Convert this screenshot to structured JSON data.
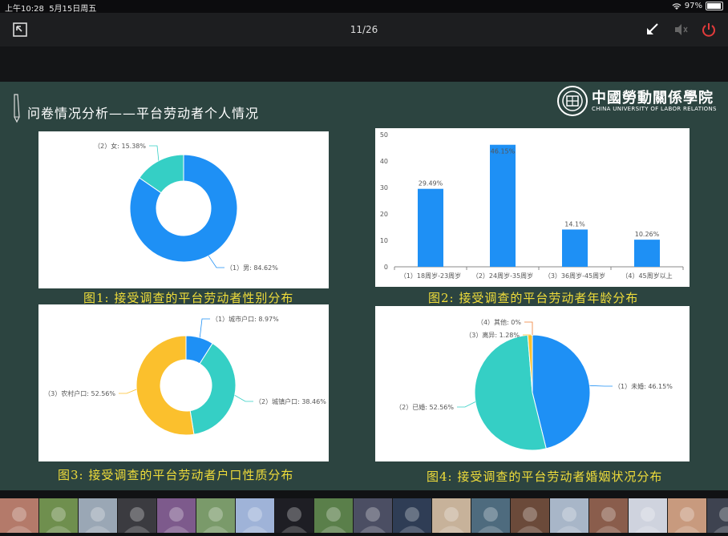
{
  "status_bar": {
    "time": "上午10:28",
    "date": "5月15日周五",
    "battery": "97%",
    "battery_level": 0.97
  },
  "toolbar": {
    "page_counter": "11/26"
  },
  "slide": {
    "title": "问卷情况分析——平台劳动者个人情况",
    "logo_cn": "中國勞動關係學院",
    "logo_en": "CHINA UNIVERSITY OF LABOR RELATIONS"
  },
  "figures": [
    {
      "caption": "图1:  接受调查的平台劳动者性别分布"
    },
    {
      "caption": "图2:  接受调查的平台劳动者年龄分布"
    },
    {
      "caption": "图3:  接受调查的平台劳动者户口性质分布"
    },
    {
      "caption": "图4:  接受调查的平台劳动者婚姻状况分布"
    }
  ],
  "chart_data": [
    {
      "type": "pie",
      "donut": true,
      "categories": [
        "（1）男",
        "（2）女"
      ],
      "values": [
        84.62,
        15.38
      ],
      "labels": [
        "（1）男: 84.62%",
        "（2）女: 15.38%"
      ],
      "colors": [
        "#1e90f5",
        "#35cfc5"
      ]
    },
    {
      "type": "bar",
      "categories": [
        "（1）18周岁-23周岁",
        "（2）24周岁-35周岁",
        "（3）36周岁-45周岁",
        "（4）45周岁以上"
      ],
      "values": [
        29.49,
        46.15,
        14.1,
        10.26
      ],
      "data_labels": [
        "29.49%",
        "46.15%",
        "14.1%",
        "10.26%"
      ],
      "ylim": [
        0,
        50
      ],
      "yticks": [
        "0",
        "10",
        "20",
        "30",
        "40",
        "50"
      ],
      "grid": false,
      "color": "#1e90f5"
    },
    {
      "type": "pie",
      "donut": true,
      "categories": [
        "（1）城市户口",
        "（2）城镇户口",
        "（3）农村户口"
      ],
      "values": [
        8.97,
        38.46,
        52.56
      ],
      "labels": [
        "（1）城市户口: 8.97%",
        "（2）城镇户口: 38.46%",
        "（3）农村户口: 52.56%"
      ],
      "colors": [
        "#1e90f5",
        "#35cfc5",
        "#fbc02d"
      ]
    },
    {
      "type": "pie",
      "donut": false,
      "categories": [
        "（1）未婚",
        "（2）已婚",
        "（3）离异",
        "（4）其他"
      ],
      "values": [
        46.15,
        52.56,
        1.28,
        0
      ],
      "labels": [
        "（1）未婚: 46.15%",
        "（2）已婚: 52.56%",
        "（3）离异: 1.28%",
        "（4）其他: 0%"
      ],
      "colors": [
        "#1e90f5",
        "#35cfc5",
        "#fbc02d",
        "#f07d33"
      ]
    }
  ],
  "participants": {
    "colors": [
      "#b47a6a",
      "#6f8f4e",
      "#9aa7b5",
      "#3b3b40",
      "#7d5a8c",
      "#7a9a6a",
      "#9fb3d8",
      "#1e1e24",
      "#5a7f4a",
      "#4b4e63",
      "#2f3d55",
      "#c7b29a",
      "#4e6b7e",
      "#6b4a3a",
      "#a8b6c8",
      "#8a5d4c",
      "#cfd3de",
      "#c89a7e",
      "#3e4350"
    ]
  }
}
